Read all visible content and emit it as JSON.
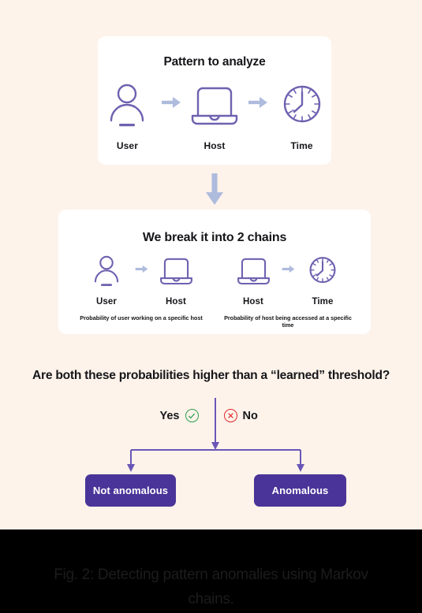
{
  "theme": {
    "page_bg": "#fdf3ea",
    "card_bg": "#ffffff",
    "icon_purple": "#6f61b0",
    "arrow_blue": "#aebbdd",
    "connector_purple": "#6a56b8",
    "button_purple": "#4a3499",
    "yes_green": "#2f9e4f",
    "no_red": "#e4262c",
    "footer_bg": "#000000",
    "caption_text": "#1c1c1c"
  },
  "pattern_card": {
    "title": "Pattern to analyze",
    "nodes": [
      {
        "icon": "user-icon",
        "label": "User"
      },
      {
        "icon": "laptop-icon",
        "label": "Host"
      },
      {
        "icon": "clock-icon",
        "label": "Time"
      }
    ],
    "arrows": [
      "arrow-right-icon",
      "arrow-right-icon"
    ]
  },
  "chains_card": {
    "title": "We break it into 2 chains",
    "chains": [
      {
        "nodes": [
          {
            "icon": "user-icon",
            "label": "User"
          },
          {
            "icon": "laptop-icon",
            "label": "Host"
          }
        ],
        "caption": "Probability of user working on a specific host"
      },
      {
        "nodes": [
          {
            "icon": "laptop-icon",
            "label": "Host"
          },
          {
            "icon": "clock-icon",
            "label": "Time"
          }
        ],
        "caption": "Probability of host being accessed at a specific time"
      }
    ]
  },
  "between_arrow": {
    "icon": "arrow-down-icon"
  },
  "decision": {
    "question": "Are both these probabilities higher than a “learned” threshold?",
    "yes": {
      "label": "Yes",
      "icon": "check-circle-icon"
    },
    "no": {
      "label": "No",
      "icon": "x-circle-icon"
    },
    "outcomes": [
      {
        "label": "Not anomalous"
      },
      {
        "label": "Anomalous"
      }
    ]
  },
  "footer": {
    "caption": "Fig. 2: Detecting pattern anomalies using Markov chains."
  }
}
